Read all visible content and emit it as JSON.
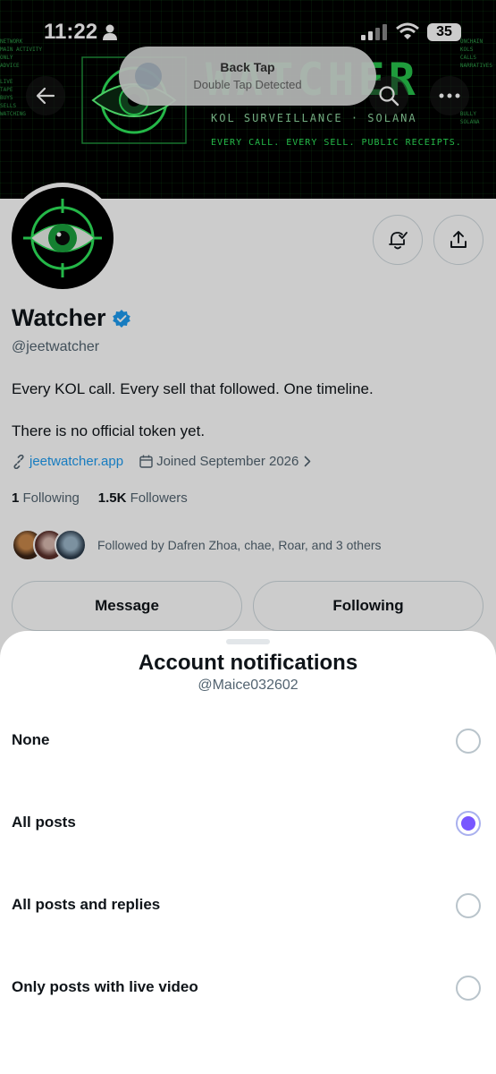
{
  "status_bar": {
    "time": "11:22",
    "battery": "35"
  },
  "toast": {
    "title": "Back Tap",
    "subtitle": "Double Tap Detected"
  },
  "banner": {
    "logo_text": "WATCHER",
    "subtitle": "KOL SURVEILLANCE · SOLANA",
    "tagline": "EVERY CALL. EVERY SELL. PUBLIC RECEIPTS.",
    "left_text": "NETWORK\nMAIN ACTIVITY\nONLY\nADVICE\n\nLIVE\nTAPE\nBUYS\nSELLS\nWATCHING",
    "right_text": "ONCHAIN\nKOLS\nCALLS\nNARRATIVES\n\n\n\n\n\nBULLY\nSOLANA"
  },
  "profile": {
    "display_name": "Watcher",
    "handle": "@jeetwatcher",
    "bio_line1": "Every KOL call. Every sell that followed. One timeline.",
    "bio_line2": "There is no official token yet.",
    "website": "jeetwatcher.app",
    "joined": "Joined September 2026",
    "following_count": "1",
    "following_label": "Following",
    "followers_count": "1.5K",
    "followers_label": "Followers",
    "followed_by": "Followed by Dafren Zhoa, chae, Roar, and 3 others",
    "message_label": "Message",
    "following_button_label": "Following"
  },
  "sheet": {
    "title": "Account notifications",
    "subtitle": "@Maice032602",
    "selected": "All posts",
    "options": [
      {
        "label": "None",
        "checked": false
      },
      {
        "label": "All posts",
        "checked": true
      },
      {
        "label": "All posts and replies",
        "checked": false
      },
      {
        "label": "Only posts with live video",
        "checked": false
      }
    ]
  },
  "colors": {
    "accent": "#7856ff",
    "link": "#1d9bf0",
    "verified": "#1d9bf0",
    "banner_green": "#2ee55a"
  },
  "icons": [
    "back-arrow-icon",
    "search-icon",
    "more-icon",
    "bell-check-icon",
    "share-icon",
    "verified-badge-icon",
    "link-icon",
    "calendar-icon",
    "chevron-right-icon"
  ]
}
